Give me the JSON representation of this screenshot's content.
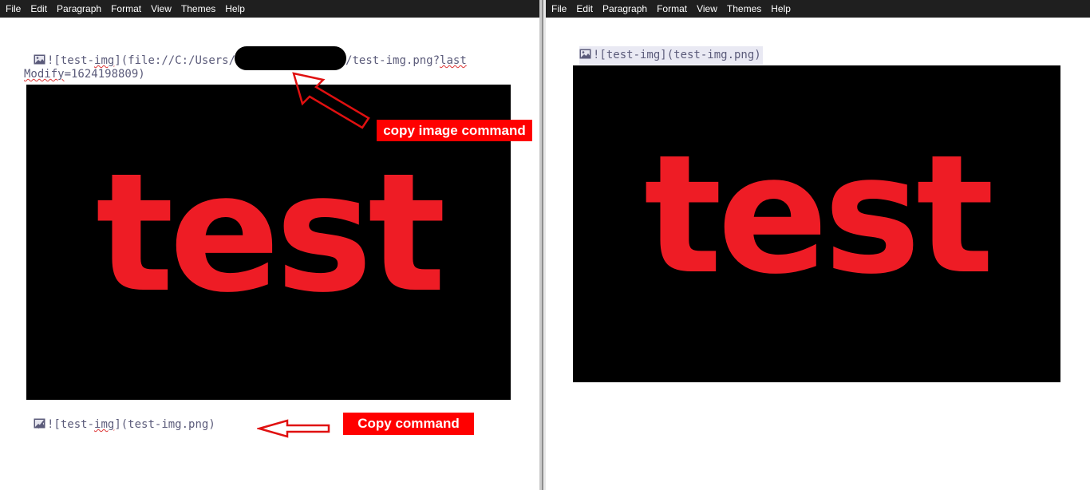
{
  "menu": [
    "File",
    "Edit",
    "Paragraph",
    "Format",
    "View",
    "Themes",
    "Help"
  ],
  "left": {
    "source_prefix": "![test-",
    "source_img_word": "img",
    "source_mid": "](file://C:/Users/",
    "source_suffix": "/test-img.png?",
    "source_last": "last",
    "line2_modify": "Modify",
    "line2_rest": "=1624198809)",
    "image_text": "test",
    "annotation_top": "copy image command",
    "copy_prefix": "![test-",
    "copy_img_word": "img",
    "copy_suffix": "](test-img.png)",
    "annotation_bottom": "Copy command"
  },
  "right": {
    "source": "![test-img](test-img.png)",
    "image_text": "test"
  },
  "colors": {
    "menubar": "#1f1f1f",
    "annotation": "#ff0000",
    "image_text": "#ee1c25",
    "markdown_text": "#5b5b7a"
  }
}
